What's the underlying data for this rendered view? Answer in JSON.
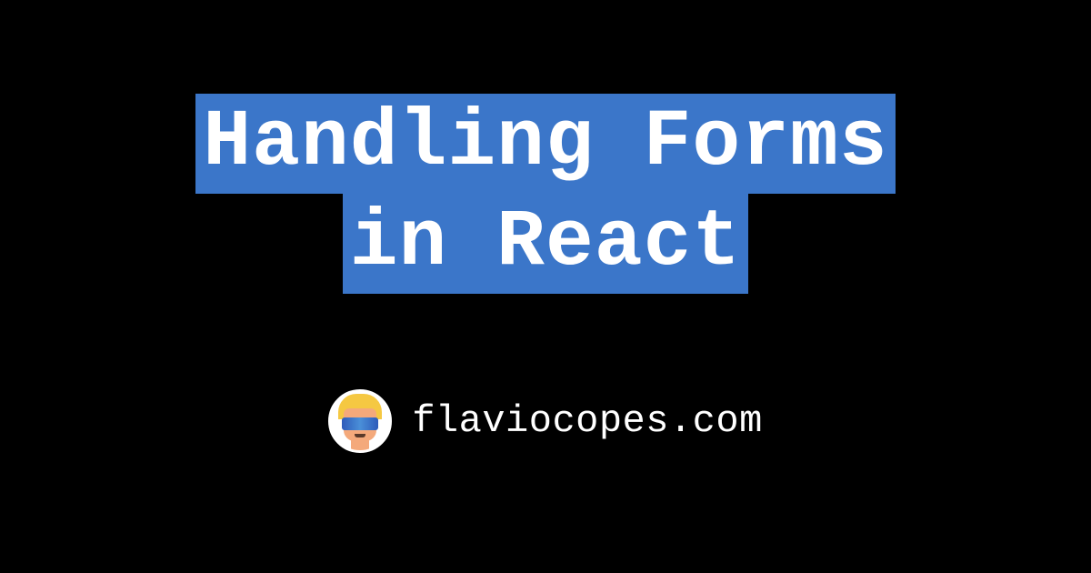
{
  "title": {
    "line1": "Handling Forms",
    "line2": "in React"
  },
  "footer": {
    "site_name": "flaviocopes.com"
  }
}
